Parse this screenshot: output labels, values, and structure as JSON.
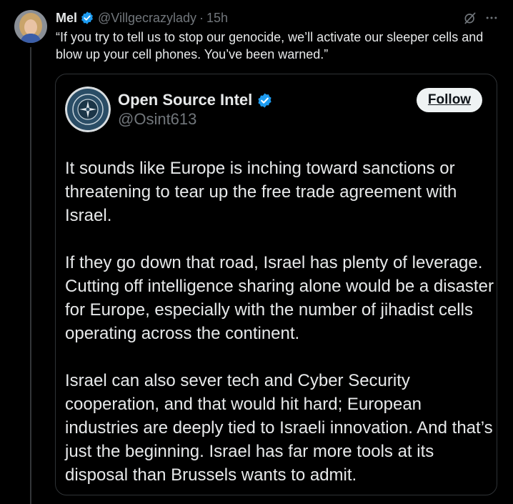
{
  "post": {
    "author_name": "Mel",
    "handle": "@Villgecrazylady",
    "separator": "·",
    "time": "15h",
    "text": "“If you try to tell us to stop our genocide, we’ll activate our sleeper cells and blow up your cell phones. You’ve been warned.”",
    "icons": [
      "verified-badge-icon",
      "grok-icon",
      "more-icon"
    ]
  },
  "quote": {
    "name": "Open Source Intel",
    "handle": "@Osint613",
    "follow_label": "Follow",
    "paragraphs": [
      "It sounds like Europe is inching toward sanctions or threatening to tear up the free trade agreement with Israel.",
      "If they go down that road, Israel has plenty of leverage. Cutting off intelligence sharing alone would be a disaster for Europe, especially with the number of jihadist cells operating across the continent.",
      "Israel can also sever tech and Cyber Security cooperation, and that would hit hard; European industries are deeply tied to Israeli innovation. And that’s just the beginning. Israel has far more tools at its disposal than Brussels wants to admit."
    ]
  },
  "colors": {
    "background": "#000000",
    "text_primary": "#e7e9ea",
    "text_secondary": "#71767b",
    "border": "#2f3336",
    "verified_blue": "#1d9bf0",
    "follow_bg": "#eff3f4"
  }
}
